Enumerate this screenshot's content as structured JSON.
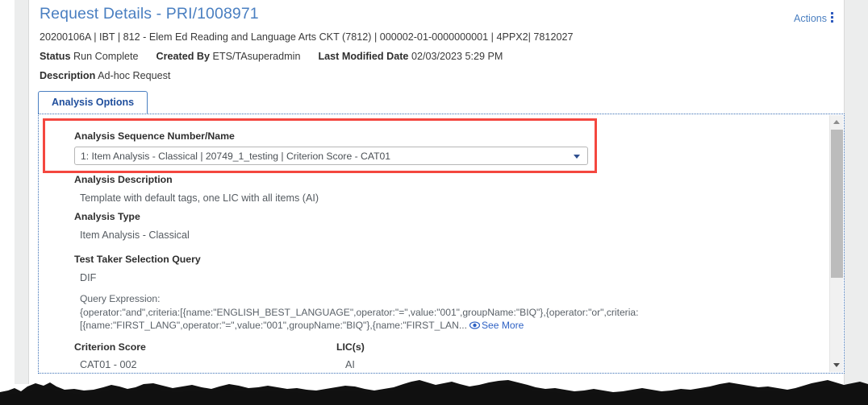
{
  "header": {
    "title": "Request Details - PRI/1008971",
    "actions_label": "Actions",
    "actions_icon": "kebab-menu-icon",
    "identifiers": "20200106A | IBT | 812 - Elem Ed Reading and Language Arts CKT (7812) | 000002-01-0000000001 | 4PPX2| 7812027",
    "status_label": "Status",
    "status_value": "Run Complete",
    "created_by_label": "Created By",
    "created_by_value": "ETS/TAsuperadmin",
    "last_modified_label": "Last Modified Date",
    "last_modified_value": "02/03/2023 5:29 PM",
    "description_label": "Description",
    "description_value": "Ad-hoc Request"
  },
  "tabs": [
    {
      "label": "Analysis Options",
      "active": true
    }
  ],
  "panel": {
    "sequence": {
      "label": "Analysis Sequence Number/Name",
      "selected": "1: Item Analysis - Classical | 20749_1_testing | Criterion Score - CAT01",
      "caret_icon": "chevron-down-icon",
      "highlighted": true,
      "highlight_color": "#f4473f"
    },
    "analysis_description": {
      "label": "Analysis Description",
      "value": "Template with default tags, one LIC with all items (AI)"
    },
    "analysis_type": {
      "label": "Analysis Type",
      "value": "Item Analysis - Classical"
    },
    "test_taker_selection_query": {
      "label": "Test Taker Selection Query",
      "value": "DIF",
      "query_expression_label": "Query Expression:",
      "query_line_1": "{operator:\"and\",criteria:[{name:\"ENGLISH_BEST_LANGUAGE\",operator:\"=\",value:\"001\",groupName:\"BIQ\"},{operator:\"or\",criteria:",
      "query_line_2": "[{name:\"FIRST_LANG\",operator:\"=\",value:\"001\",groupName:\"BIQ\"},{name:\"FIRST_LAN...",
      "see_more_label": "See More",
      "see_more_icon": "eye-icon"
    },
    "table": {
      "columns": [
        "Criterion Score",
        "LIC(s)"
      ],
      "rows": [
        {
          "criterion_score": "CAT01 - 002",
          "lics": "AI"
        }
      ]
    },
    "scrollbar": {
      "up_icon": "triangle-up-icon",
      "down_icon": "triangle-down-icon",
      "thumb": "scrollbar-thumb"
    }
  },
  "colors": {
    "link": "#4a7fc1",
    "tab_border": "#4a7fc1",
    "highlight": "#f4473f",
    "panel_border": "#3b6fb5"
  }
}
